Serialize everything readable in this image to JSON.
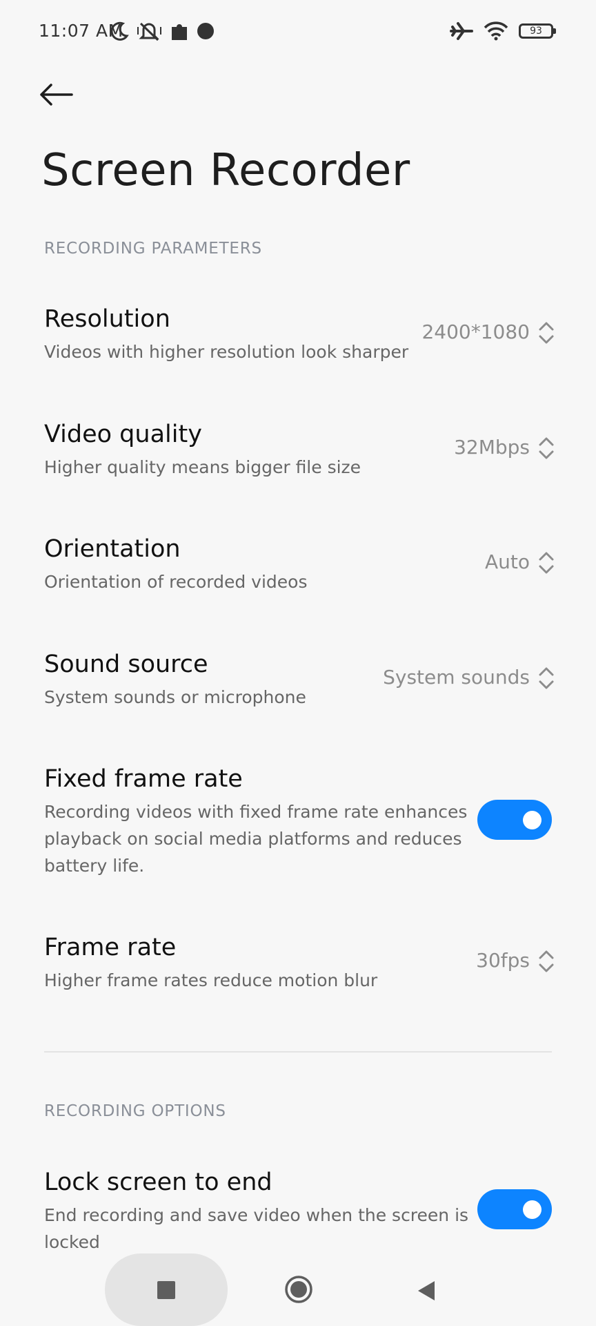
{
  "status_bar": {
    "time": "11:07 AM",
    "battery": "93",
    "left_icons": [
      "moon-icon",
      "muted-vibrate-icon",
      "puzzle-icon",
      "dot-icon"
    ],
    "right_icons": [
      "airplane-icon",
      "wifi-icon",
      "battery-icon"
    ]
  },
  "header": {
    "title": "Screen Recorder"
  },
  "sections": {
    "recording_parameters": "RECORDING PARAMETERS",
    "recording_options": "RECORDING OPTIONS"
  },
  "settings": {
    "resolution": {
      "title": "Resolution",
      "desc": "Videos with higher resolution look sharper",
      "value": "2400*1080"
    },
    "video_quality": {
      "title": "Video quality",
      "desc": "Higher quality means bigger file size",
      "value": "32Mbps"
    },
    "orientation": {
      "title": "Orientation",
      "desc": "Orientation of recorded videos",
      "value": "Auto"
    },
    "sound_source": {
      "title": "Sound source",
      "desc": "System sounds or microphone",
      "value": "System sounds"
    },
    "fixed_frame_rate": {
      "title": "Fixed frame rate",
      "desc_line1": "Recording videos with fixed frame rate enhances",
      "desc_line2": "playback on social media platforms and reduces",
      "desc_line3": "battery life.",
      "enabled": true
    },
    "frame_rate": {
      "title": "Frame rate",
      "desc": "Higher frame rates reduce motion blur",
      "value": "30fps"
    },
    "lock_screen_to_end": {
      "title": "Lock screen to end",
      "desc_line1": "End recording and save video when the screen is",
      "desc_line2": "locked",
      "enabled": true
    }
  },
  "colors": {
    "accent": "#0d84ff",
    "background": "#f7f7f7",
    "section_header": "#8a8f98"
  }
}
